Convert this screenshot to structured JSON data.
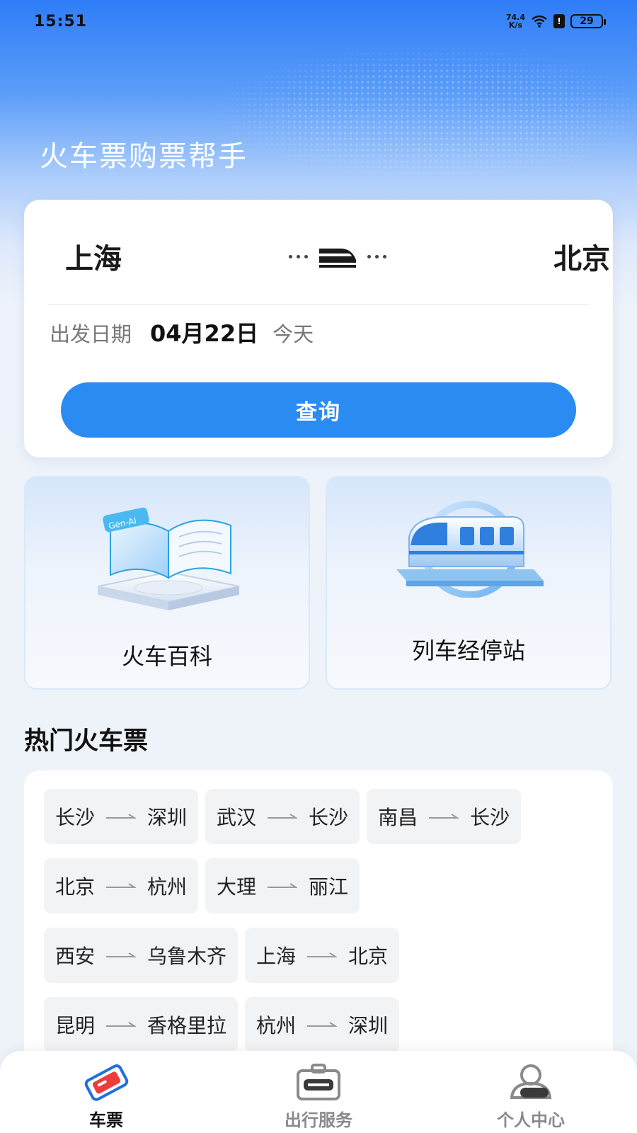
{
  "status_bar": {
    "time": "15:51",
    "speed_value": "74.4",
    "speed_unit": "K/s",
    "battery": "29"
  },
  "app": {
    "title": "火车票购票帮手"
  },
  "search": {
    "from_city": "上海",
    "to_city": "北京",
    "date_label": "出发日期",
    "date_value": "04月22日",
    "date_hint": "今天",
    "query_button": "查询"
  },
  "features": {
    "encyclopedia": {
      "label": "火车百科",
      "badge": "Gen-AI"
    },
    "stations": {
      "label": "列车经停站"
    }
  },
  "hot_tickets": {
    "title": "热门火车票",
    "rows": [
      [
        {
          "from": "长沙",
          "to": "深圳"
        },
        {
          "from": "武汉",
          "to": "长沙"
        },
        {
          "from": "南昌",
          "to": "长沙"
        }
      ],
      [
        {
          "from": "北京",
          "to": "杭州"
        },
        {
          "from": "大理",
          "to": "丽江"
        }
      ],
      [
        {
          "from": "西安",
          "to": "乌鲁木齐"
        },
        {
          "from": "上海",
          "to": "北京"
        }
      ],
      [
        {
          "from": "昆明",
          "to": "香格里拉"
        },
        {
          "from": "杭州",
          "to": "深圳"
        }
      ]
    ]
  },
  "tabbar": {
    "tickets": "车票",
    "travel_services": "出行服务",
    "personal_center": "个人中心"
  },
  "colors": {
    "primary": "#2a8bf2",
    "hero_top": "#2f7df7",
    "accent_red": "#ef3b3b"
  }
}
